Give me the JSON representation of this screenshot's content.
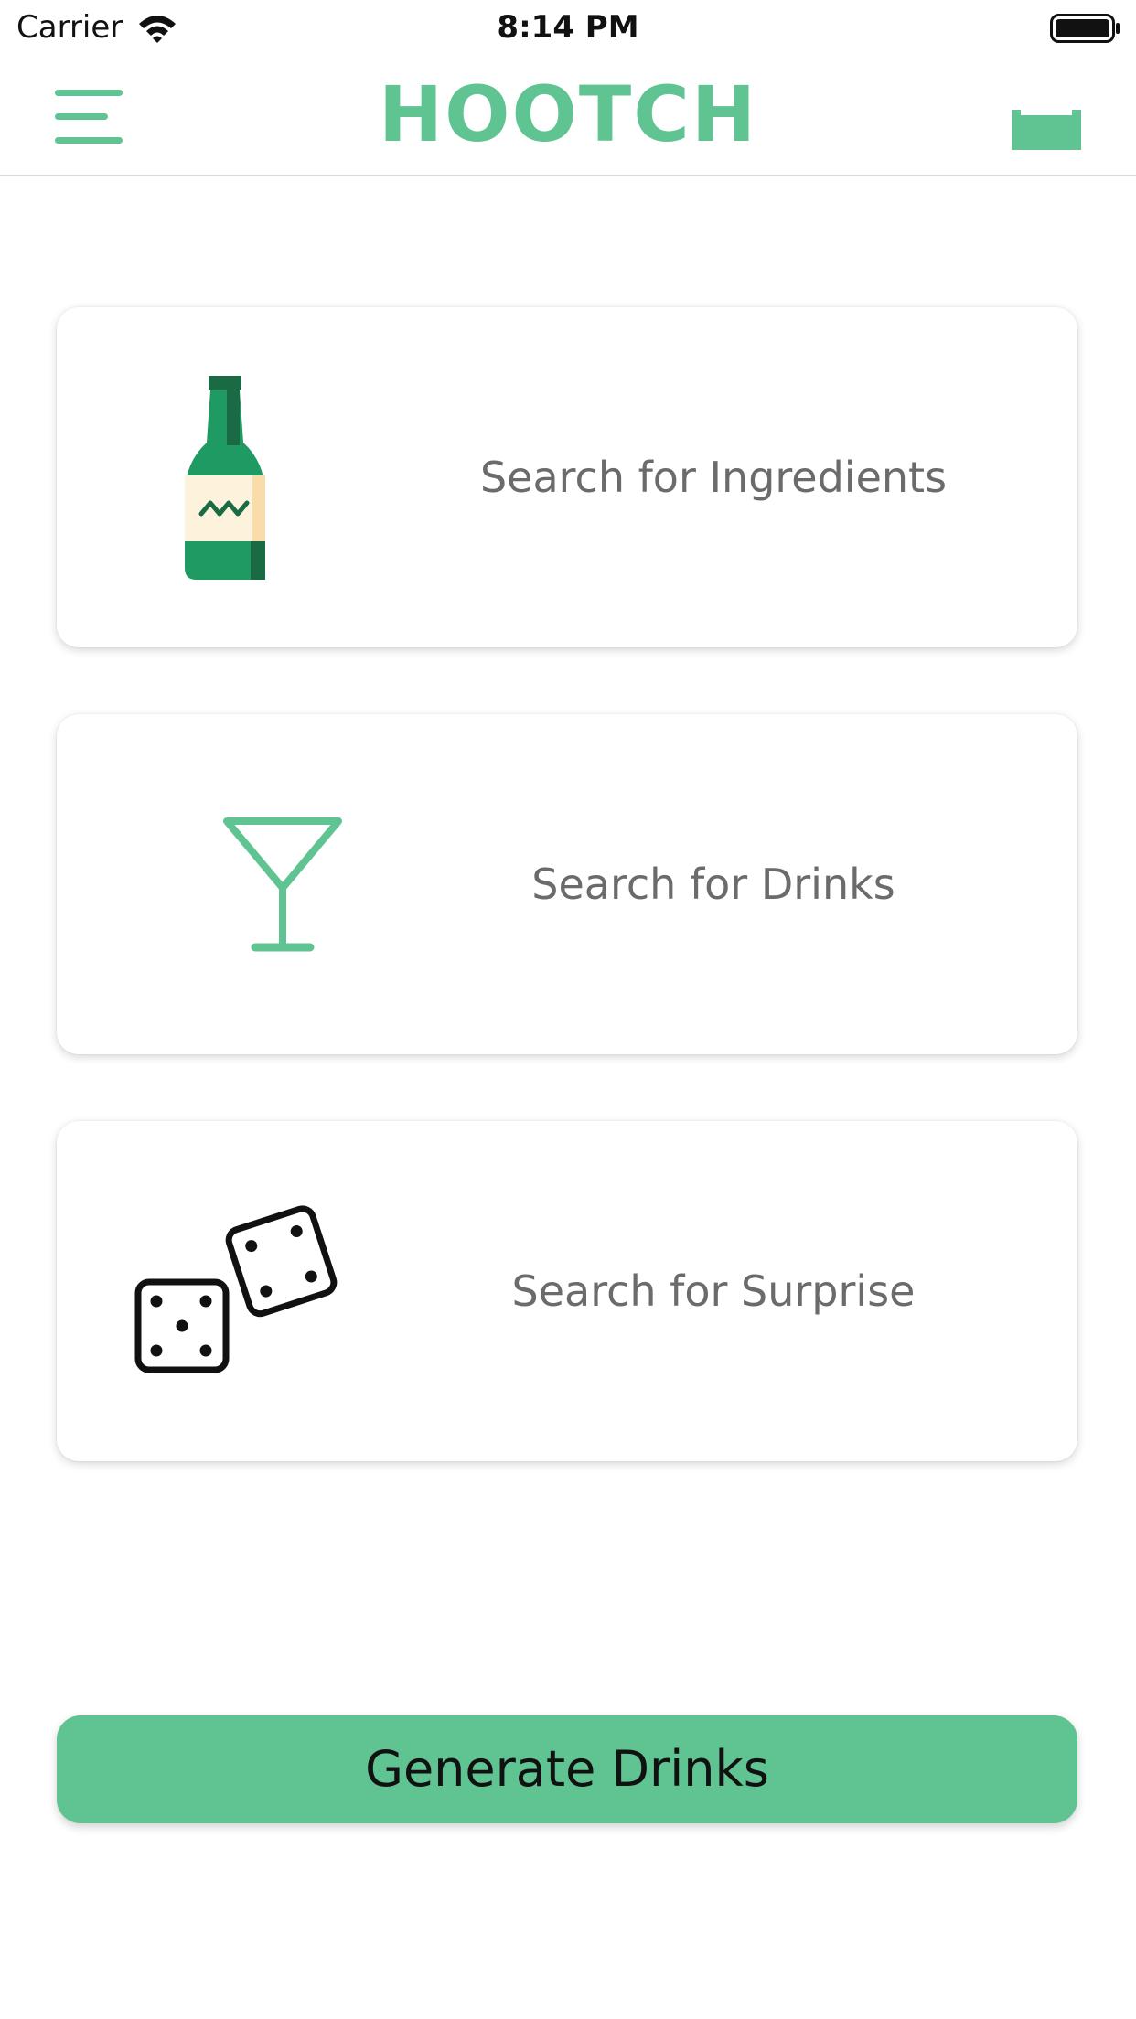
{
  "status_bar": {
    "carrier": "Carrier",
    "time": "8:14 PM",
    "icons": [
      "wifi-icon",
      "battery-icon"
    ]
  },
  "header": {
    "title": "HOOTCH",
    "left_icon": "hamburger-menu-icon",
    "right_icon": "tray-icon"
  },
  "cards": [
    {
      "label": "Search for Ingredients",
      "icon": "bottle-icon"
    },
    {
      "label": "Search for Drinks",
      "icon": "martini-glass-icon"
    },
    {
      "label": "Search for Surprise",
      "icon": "dice-icon"
    }
  ],
  "generate_button": {
    "label": "Generate Drinks"
  },
  "colors": {
    "accent": "#5fc492",
    "bottle_green": "#1e9a62",
    "bottle_dark": "#1a6b45",
    "label_cream": "#fdf3dc",
    "card_text": "#6b6b6b"
  }
}
